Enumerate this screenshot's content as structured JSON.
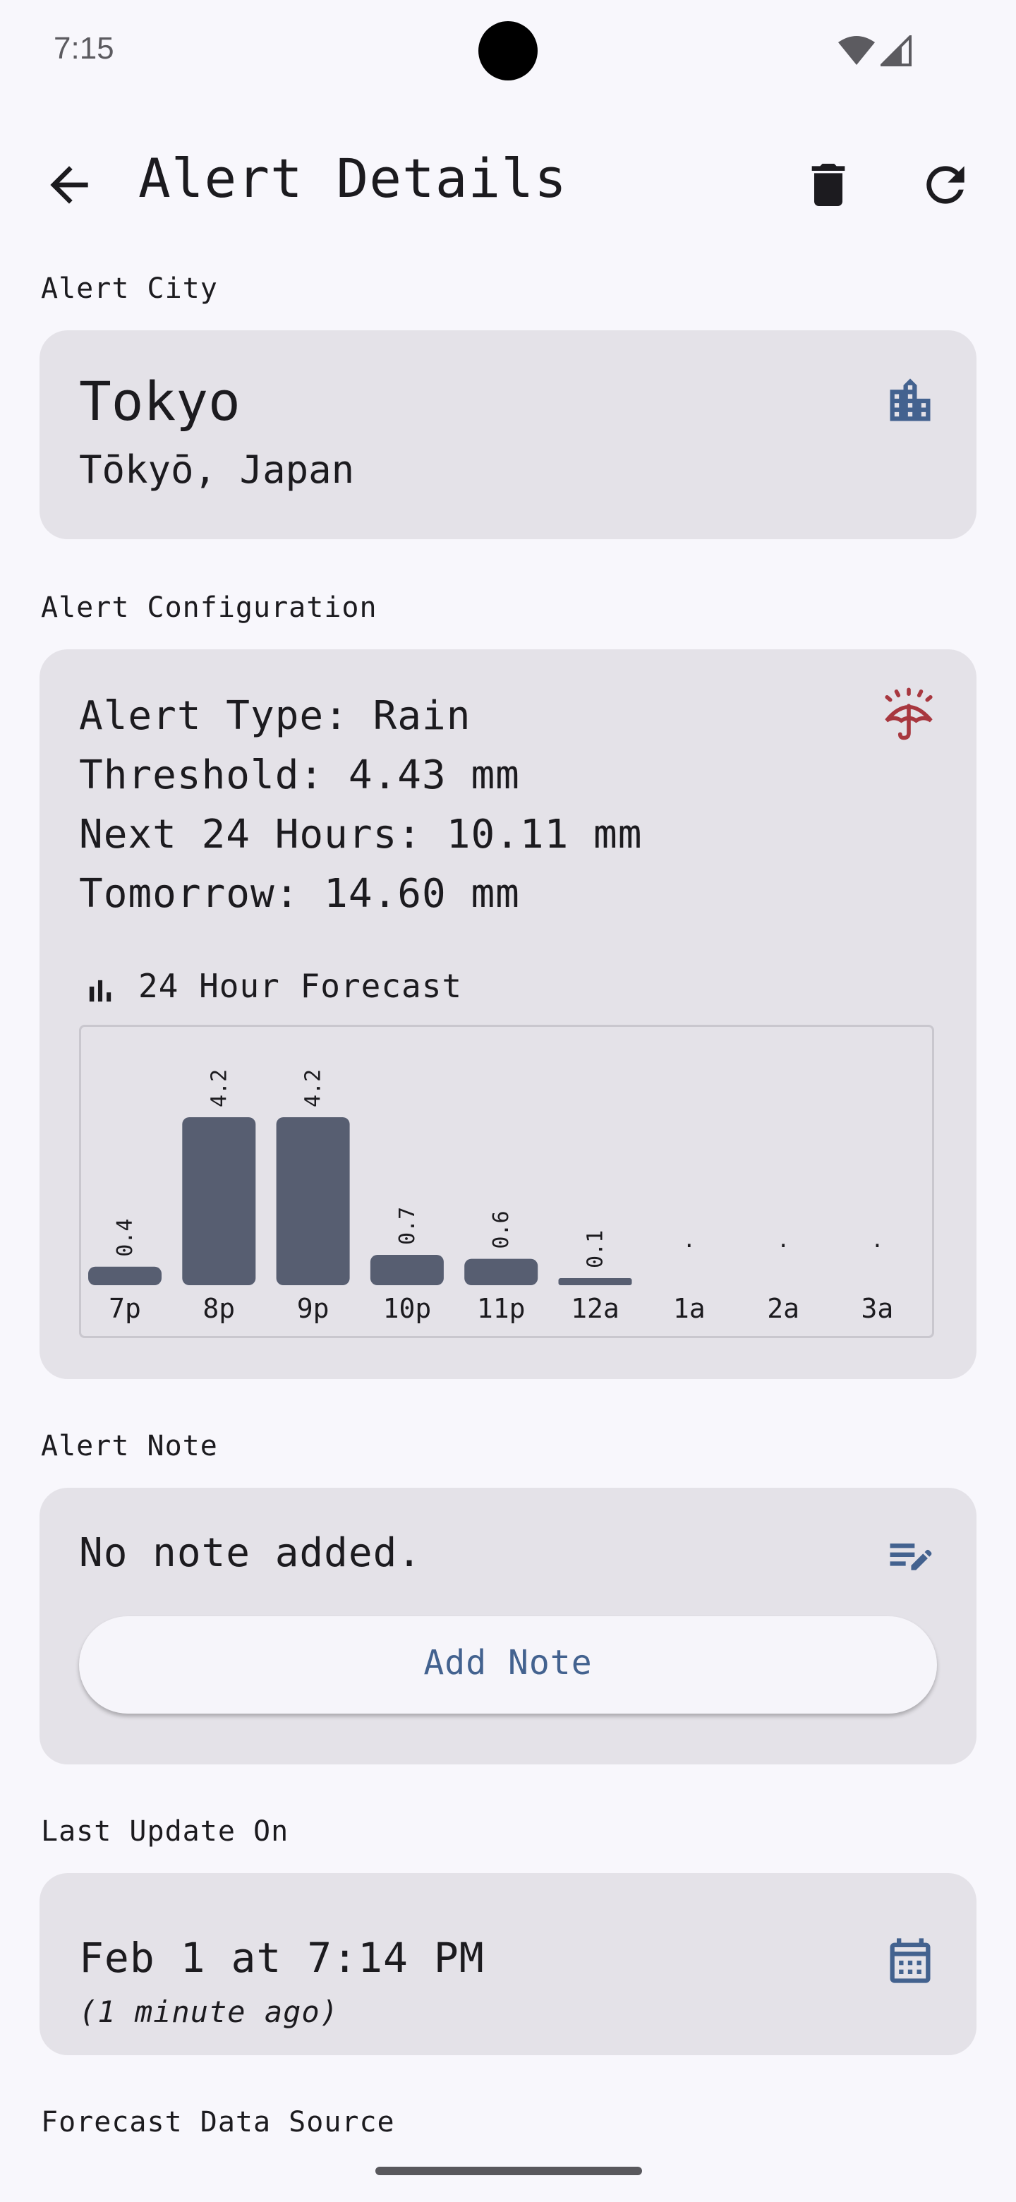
{
  "status_bar": {
    "time": "7:15"
  },
  "header": {
    "title": "Alert Details"
  },
  "sections": {
    "city_label": "Alert City",
    "config_label": "Alert Configuration",
    "note_label": "Alert Note",
    "update_label": "Last Update On",
    "source_label": "Forecast Data Source"
  },
  "city": {
    "name": "Tokyo",
    "region": "Tōkyō, Japan"
  },
  "config": {
    "alert_type": "Alert Type: Rain",
    "threshold": "Threshold: 4.43 mm",
    "next24": "Next 24 Hours: 10.11 mm",
    "tomorrow": "Tomorrow: 14.60 mm"
  },
  "forecast": {
    "title": "24 Hour Forecast"
  },
  "chart_data": {
    "type": "bar",
    "categories": [
      "7p",
      "8p",
      "9p",
      "10p",
      "11p",
      "12a",
      "1a",
      "2a",
      "3a"
    ],
    "values": [
      0.4,
      4.2,
      4.2,
      0.7,
      0.6,
      0.1,
      0,
      0,
      0
    ],
    "labels": [
      "0.4",
      "4.2",
      "4.2",
      "0.7",
      "0.6",
      "0.1",
      ".",
      ".",
      "."
    ],
    "ylim": [
      0,
      4.2
    ],
    "bar_color": "#575e71"
  },
  "note": {
    "text": "No note added.",
    "button": "Add Note"
  },
  "last_update": {
    "date": "Feb 1 at 7:14 PM",
    "relative": "(1 minute ago)"
  },
  "colors": {
    "icon_blue": "#43628f",
    "rain_red": "#a8373f",
    "card_bg": "#e4e2e8"
  },
  "icons": {
    "city": "building-icon",
    "config": "umbrella-rain-icon",
    "forecast": "bar-chart-icon",
    "note": "edit-note-icon",
    "date": "calendar-icon"
  }
}
